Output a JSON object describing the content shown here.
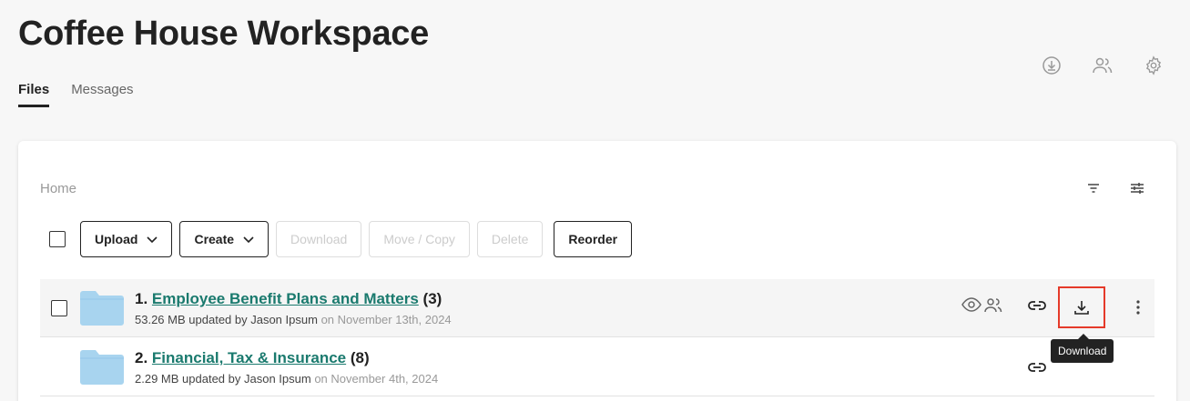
{
  "page": {
    "title": "Coffee House Workspace"
  },
  "tabs": [
    {
      "label": "Files",
      "active": true
    },
    {
      "label": "Messages",
      "active": false
    }
  ],
  "breadcrumb": "Home",
  "toolbar": {
    "upload": "Upload",
    "create": "Create",
    "download": "Download",
    "move_copy": "Move / Copy",
    "delete": "Delete",
    "reorder": "Reorder"
  },
  "rows": [
    {
      "index": "1.",
      "name": "Employee Benefit Plans and Matters",
      "count": "(3)",
      "size": "53.26 MB",
      "updated_by": "updated by Jason Ipsum",
      "date": "on November 13th, 2024"
    },
    {
      "index": "2.",
      "name": "Financial, Tax & Insurance",
      "count": "(8)",
      "size": "2.29 MB",
      "updated_by": "updated by Jason Ipsum",
      "date": "on November 4th, 2024"
    }
  ],
  "tooltip": "Download",
  "colors": {
    "link": "#1a7a6e",
    "folder": "#a8d4ef",
    "highlight": "#e53a2a"
  },
  "icons": [
    "download-circle-icon",
    "users-icon",
    "gear-icon",
    "filter-icon",
    "sliders-icon",
    "eye-icon",
    "link-icon",
    "download-icon",
    "more-vertical-icon",
    "folder-icon",
    "chevron-down-icon"
  ]
}
